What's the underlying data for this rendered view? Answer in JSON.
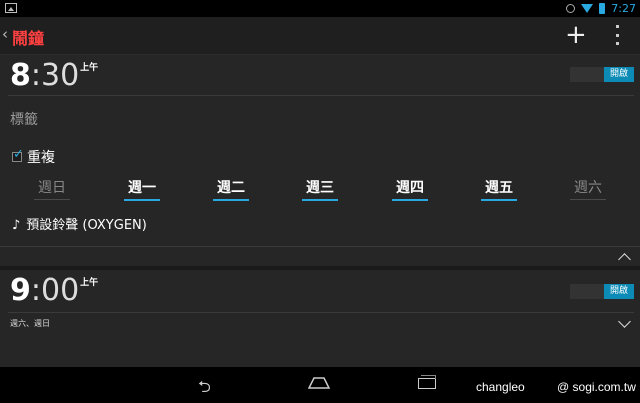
{
  "status_bar": {
    "time": "7:27"
  },
  "app_bar": {
    "back_glyph": "‹",
    "title": "鬧鐘",
    "add_glyph": "+"
  },
  "alarm1": {
    "hour": "8",
    "minutes": ":30",
    "ampm": "上午",
    "toggle_label": "開啟",
    "label_placeholder": "標籤",
    "repeat_label": "重複",
    "repeat_checked": true,
    "days": [
      {
        "label": "週日",
        "selected": false
      },
      {
        "label": "週一",
        "selected": true
      },
      {
        "label": "週二",
        "selected": true
      },
      {
        "label": "週三",
        "selected": true
      },
      {
        "label": "週四",
        "selected": true
      },
      {
        "label": "週五",
        "selected": true
      },
      {
        "label": "週六",
        "selected": false
      }
    ],
    "ringtone_icon": "music-note-icon",
    "ringtone_glyph": "♪",
    "ringtone": "預設鈴聲 (OXYGEN)"
  },
  "alarm2": {
    "hour": "9",
    "minutes": ":00",
    "ampm": "上午",
    "toggle_label": "開啟",
    "days_summary": "週六、週日"
  },
  "nav_bar": {
    "back_glyph": "⮌"
  },
  "watermark": {
    "left": "changleo",
    "right": "@ sogi.com.tw"
  },
  "colors": {
    "accent": "#2aa9e0",
    "title_red": "#ff4040",
    "toggle_on": "#0b8bb5"
  }
}
